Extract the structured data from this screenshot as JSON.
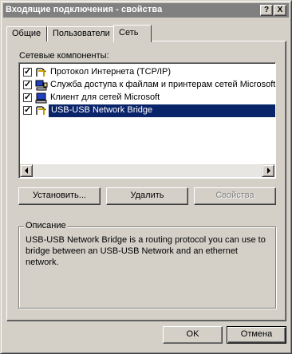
{
  "window": {
    "title": "Входящие подключения - свойства",
    "help_btn": "?",
    "close_btn": "X"
  },
  "tabs": [
    {
      "label": "Общие",
      "active": false
    },
    {
      "label": "Пользователи",
      "active": false
    },
    {
      "label": "Сеть",
      "active": true
    }
  ],
  "network": {
    "components_label": "Сетевые компоненты:",
    "items": [
      {
        "label": "Протокол Интернета (TCP/IP)",
        "checked": true,
        "icon": "protocol-icon",
        "selected": false
      },
      {
        "label": "Служба доступа к файлам и принтерам сетей Microsoft",
        "checked": true,
        "icon": "service-icon",
        "selected": false
      },
      {
        "label": "Клиент для сетей Microsoft",
        "checked": true,
        "icon": "client-icon",
        "selected": false
      },
      {
        "label": "USB-USB Network Bridge",
        "checked": true,
        "icon": "protocol-icon",
        "selected": true
      }
    ],
    "check_mark": "✓",
    "install_button": "Установить...",
    "remove_button": "Удалить",
    "properties_button": "Свойства"
  },
  "description": {
    "title": "Описание",
    "text": "USB-USB Network Bridge is a routing protocol you can use to bridge between an USB-USB Network and an ethernet network."
  },
  "footer": {
    "ok_button": "OK",
    "cancel_button": "Отмена"
  },
  "colors": {
    "face": "#d4d0c8",
    "selection": "#0a246a",
    "titlebar_inactive": "#808080"
  }
}
